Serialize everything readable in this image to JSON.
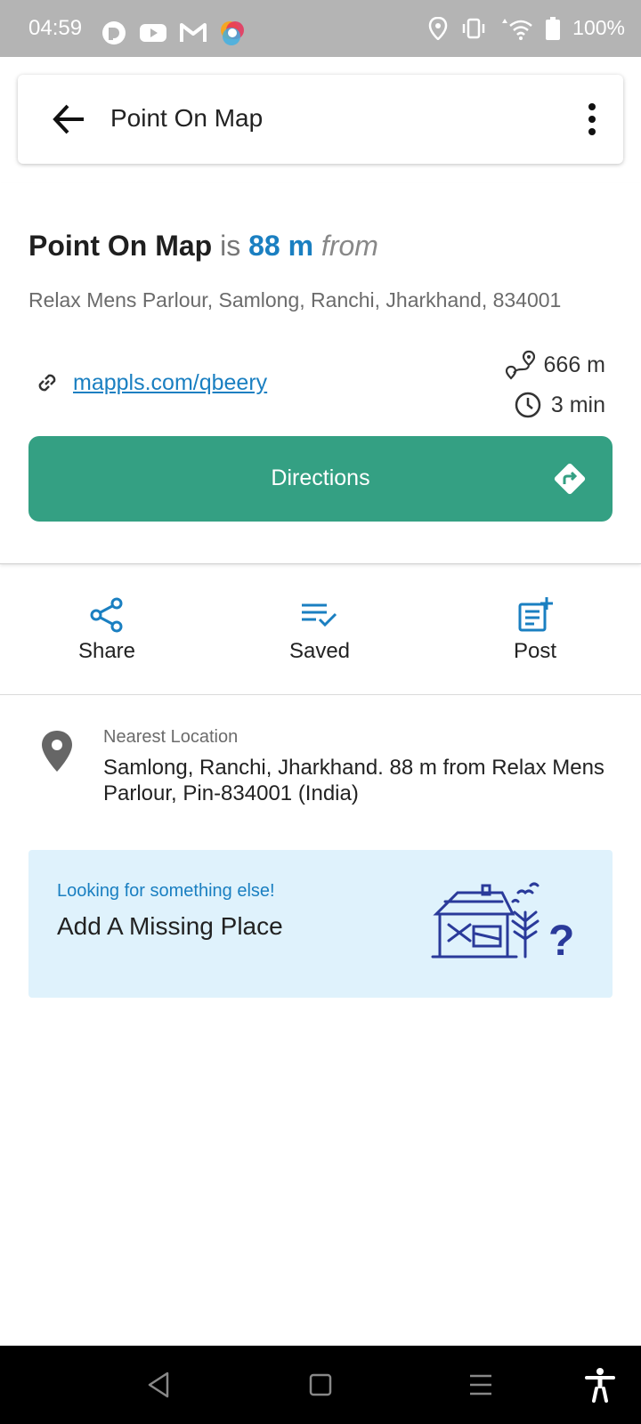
{
  "status_bar": {
    "time": "04:59",
    "battery": "100%",
    "icons": [
      "pocket-casts-icon",
      "youtube-icon",
      "gmail-icon",
      "colorful-app-icon",
      "location-icon",
      "vibrate-icon",
      "data-arrows-icon",
      "wifi-icon",
      "battery-icon"
    ]
  },
  "app_bar": {
    "title": "Point On Map"
  },
  "header": {
    "name": "Point On Map",
    "is_word": "is",
    "distance": "88 m",
    "from_word": "from",
    "address": "Relax Mens Parlour, Samlong, Ranchi, Jharkhand, 834001",
    "link": "mappls.com/qbeery",
    "route_distance": "666 m",
    "route_time": "3 min",
    "directions_label": "Directions"
  },
  "actions": [
    {
      "label": "Share",
      "icon": "share-icon"
    },
    {
      "label": "Saved",
      "icon": "saved-list-icon"
    },
    {
      "label": "Post",
      "icon": "post-add-icon"
    }
  ],
  "nearest": {
    "label": "Nearest Location",
    "text": "Samlong, Ranchi, Jharkhand. 88 m from Relax Mens Parlour, Pin-834001 (India)"
  },
  "missing_place": {
    "subtitle": "Looking for something else!",
    "title": "Add A Missing Place"
  },
  "colors": {
    "accent_blue": "#1a7fc1",
    "directions_green": "#34a083",
    "card_bg": "#dff2fc",
    "illustration_navy": "#2a3a9a"
  }
}
